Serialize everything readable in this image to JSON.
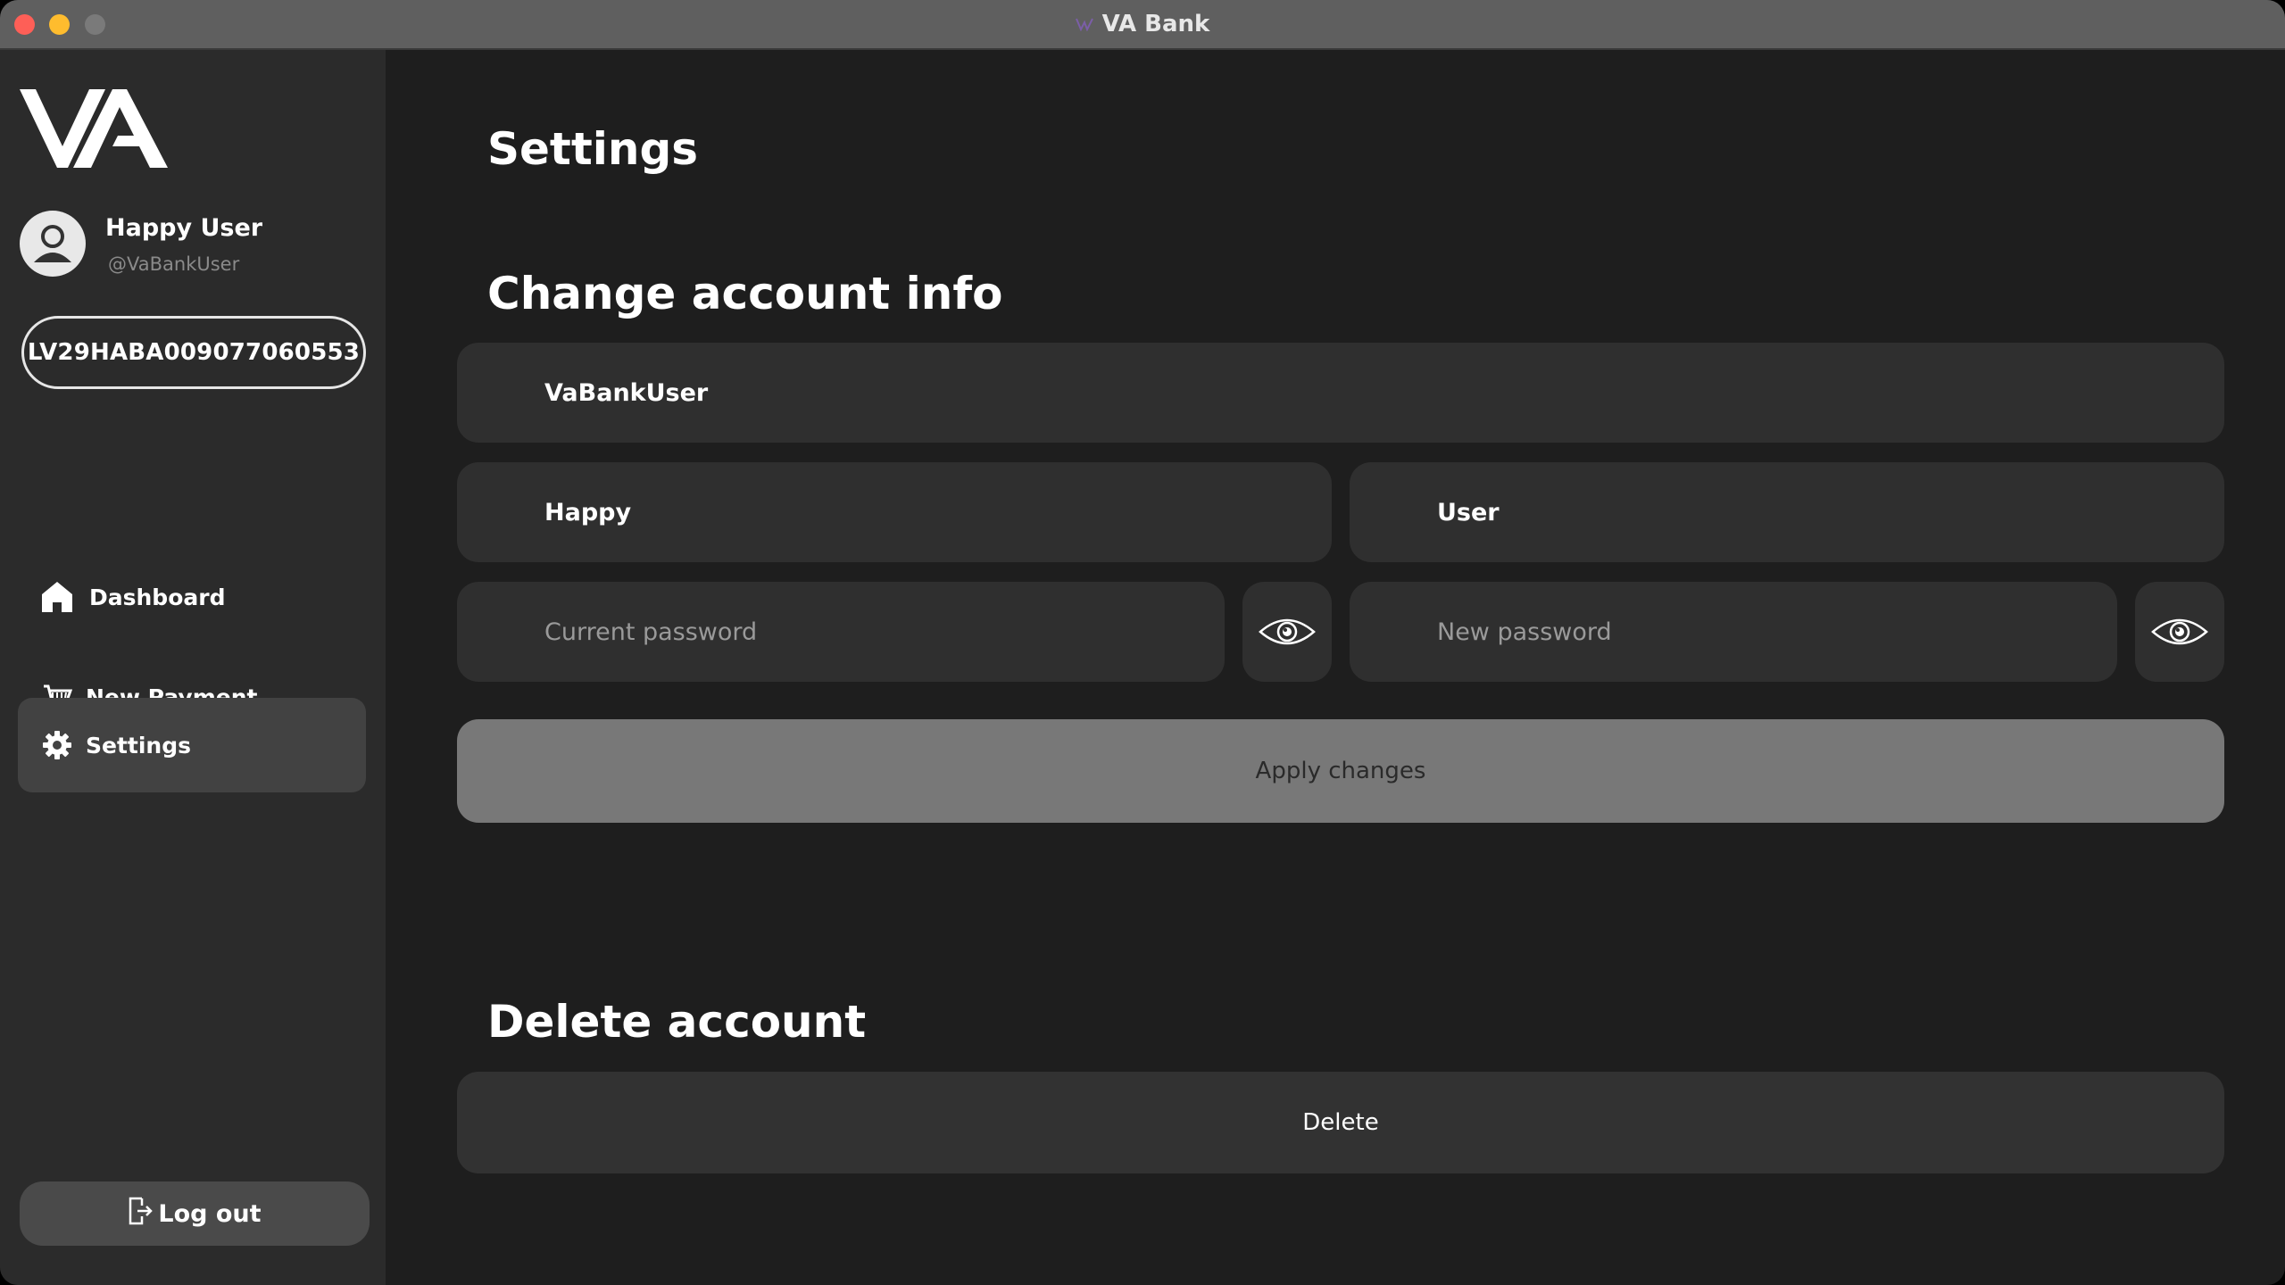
{
  "window": {
    "title": "VA Bank"
  },
  "user": {
    "name": "Happy User",
    "handle": "@VaBankUser",
    "iban": "LV29HABA009077060553"
  },
  "nav": {
    "dashboard": "Dashboard",
    "new_payment": "New Payment",
    "settings": "Settings",
    "logout": "Log out"
  },
  "page": {
    "title": "Settings"
  },
  "account_info": {
    "heading": "Change account info",
    "username": "VaBankUser",
    "first_name": "Happy",
    "last_name": "User",
    "current_password_placeholder": "Current password",
    "new_password_placeholder": "New password",
    "apply_label": "Apply changes"
  },
  "delete_section": {
    "heading": "Delete account",
    "button_label": "Delete"
  },
  "icons": {
    "logo": "va-logo-icon",
    "avatar": "user-avatar-icon",
    "dashboard": "home-icon",
    "new_payment": "cart-icon",
    "settings": "gear-icon",
    "logout": "logout-icon",
    "show_password": "eye-icon"
  },
  "colors": {
    "background": "#1e1e1e",
    "sidebar": "#2b2b2b",
    "field": "#2f2f2f",
    "apply_button": "#787878",
    "active_nav": "#424242",
    "title_logo_accent": "#7b5ea7"
  }
}
